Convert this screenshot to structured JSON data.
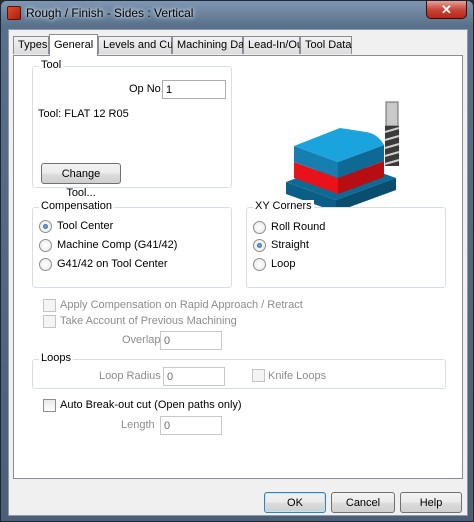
{
  "window": {
    "title": "Rough / Finish - Sides : Vertical",
    "close_glyph": "✕"
  },
  "tabs": [
    {
      "label": "Types"
    },
    {
      "label": "General"
    },
    {
      "label": "Levels and Cuts"
    },
    {
      "label": "Machining Data"
    },
    {
      "label": "Lead-In/Out"
    },
    {
      "label": "Tool Data"
    }
  ],
  "tool": {
    "group_label": "Tool",
    "op_no_label": "Op No.",
    "op_no_value": "1",
    "tool_text": "Tool: FLAT 12 R05",
    "change_tool_label": "Change Tool..."
  },
  "compensation": {
    "group_label": "Compensation",
    "options": [
      "Tool Center",
      "Machine Comp (G41/42)",
      "G41/42 on Tool Center"
    ],
    "selected": "Tool Center"
  },
  "xy_corners": {
    "group_label": "XY Corners",
    "options": [
      "Roll Round",
      "Straight",
      "Loop"
    ],
    "selected": "Straight"
  },
  "options": {
    "apply_comp_label": "Apply Compensation on Rapid Approach / Retract",
    "take_account_label": "Take Account of Previous Machining",
    "overlap_label": "Overlap",
    "overlap_value": "0"
  },
  "loops": {
    "group_label": "Loops",
    "loop_radius_label": "Loop Radius",
    "loop_radius_value": "0",
    "knife_loops_label": "Knife Loops"
  },
  "breakout": {
    "auto_breakout_label": "Auto Break-out cut (Open paths only)",
    "length_label": "Length",
    "length_value": "0"
  },
  "footer": {
    "ok_label": "OK",
    "cancel_label": "Cancel",
    "help_label": "Help"
  },
  "colors": {
    "block_top": "#1aa3dc",
    "block_side": "#0d6f9c",
    "cut_band": "#e8131a"
  }
}
